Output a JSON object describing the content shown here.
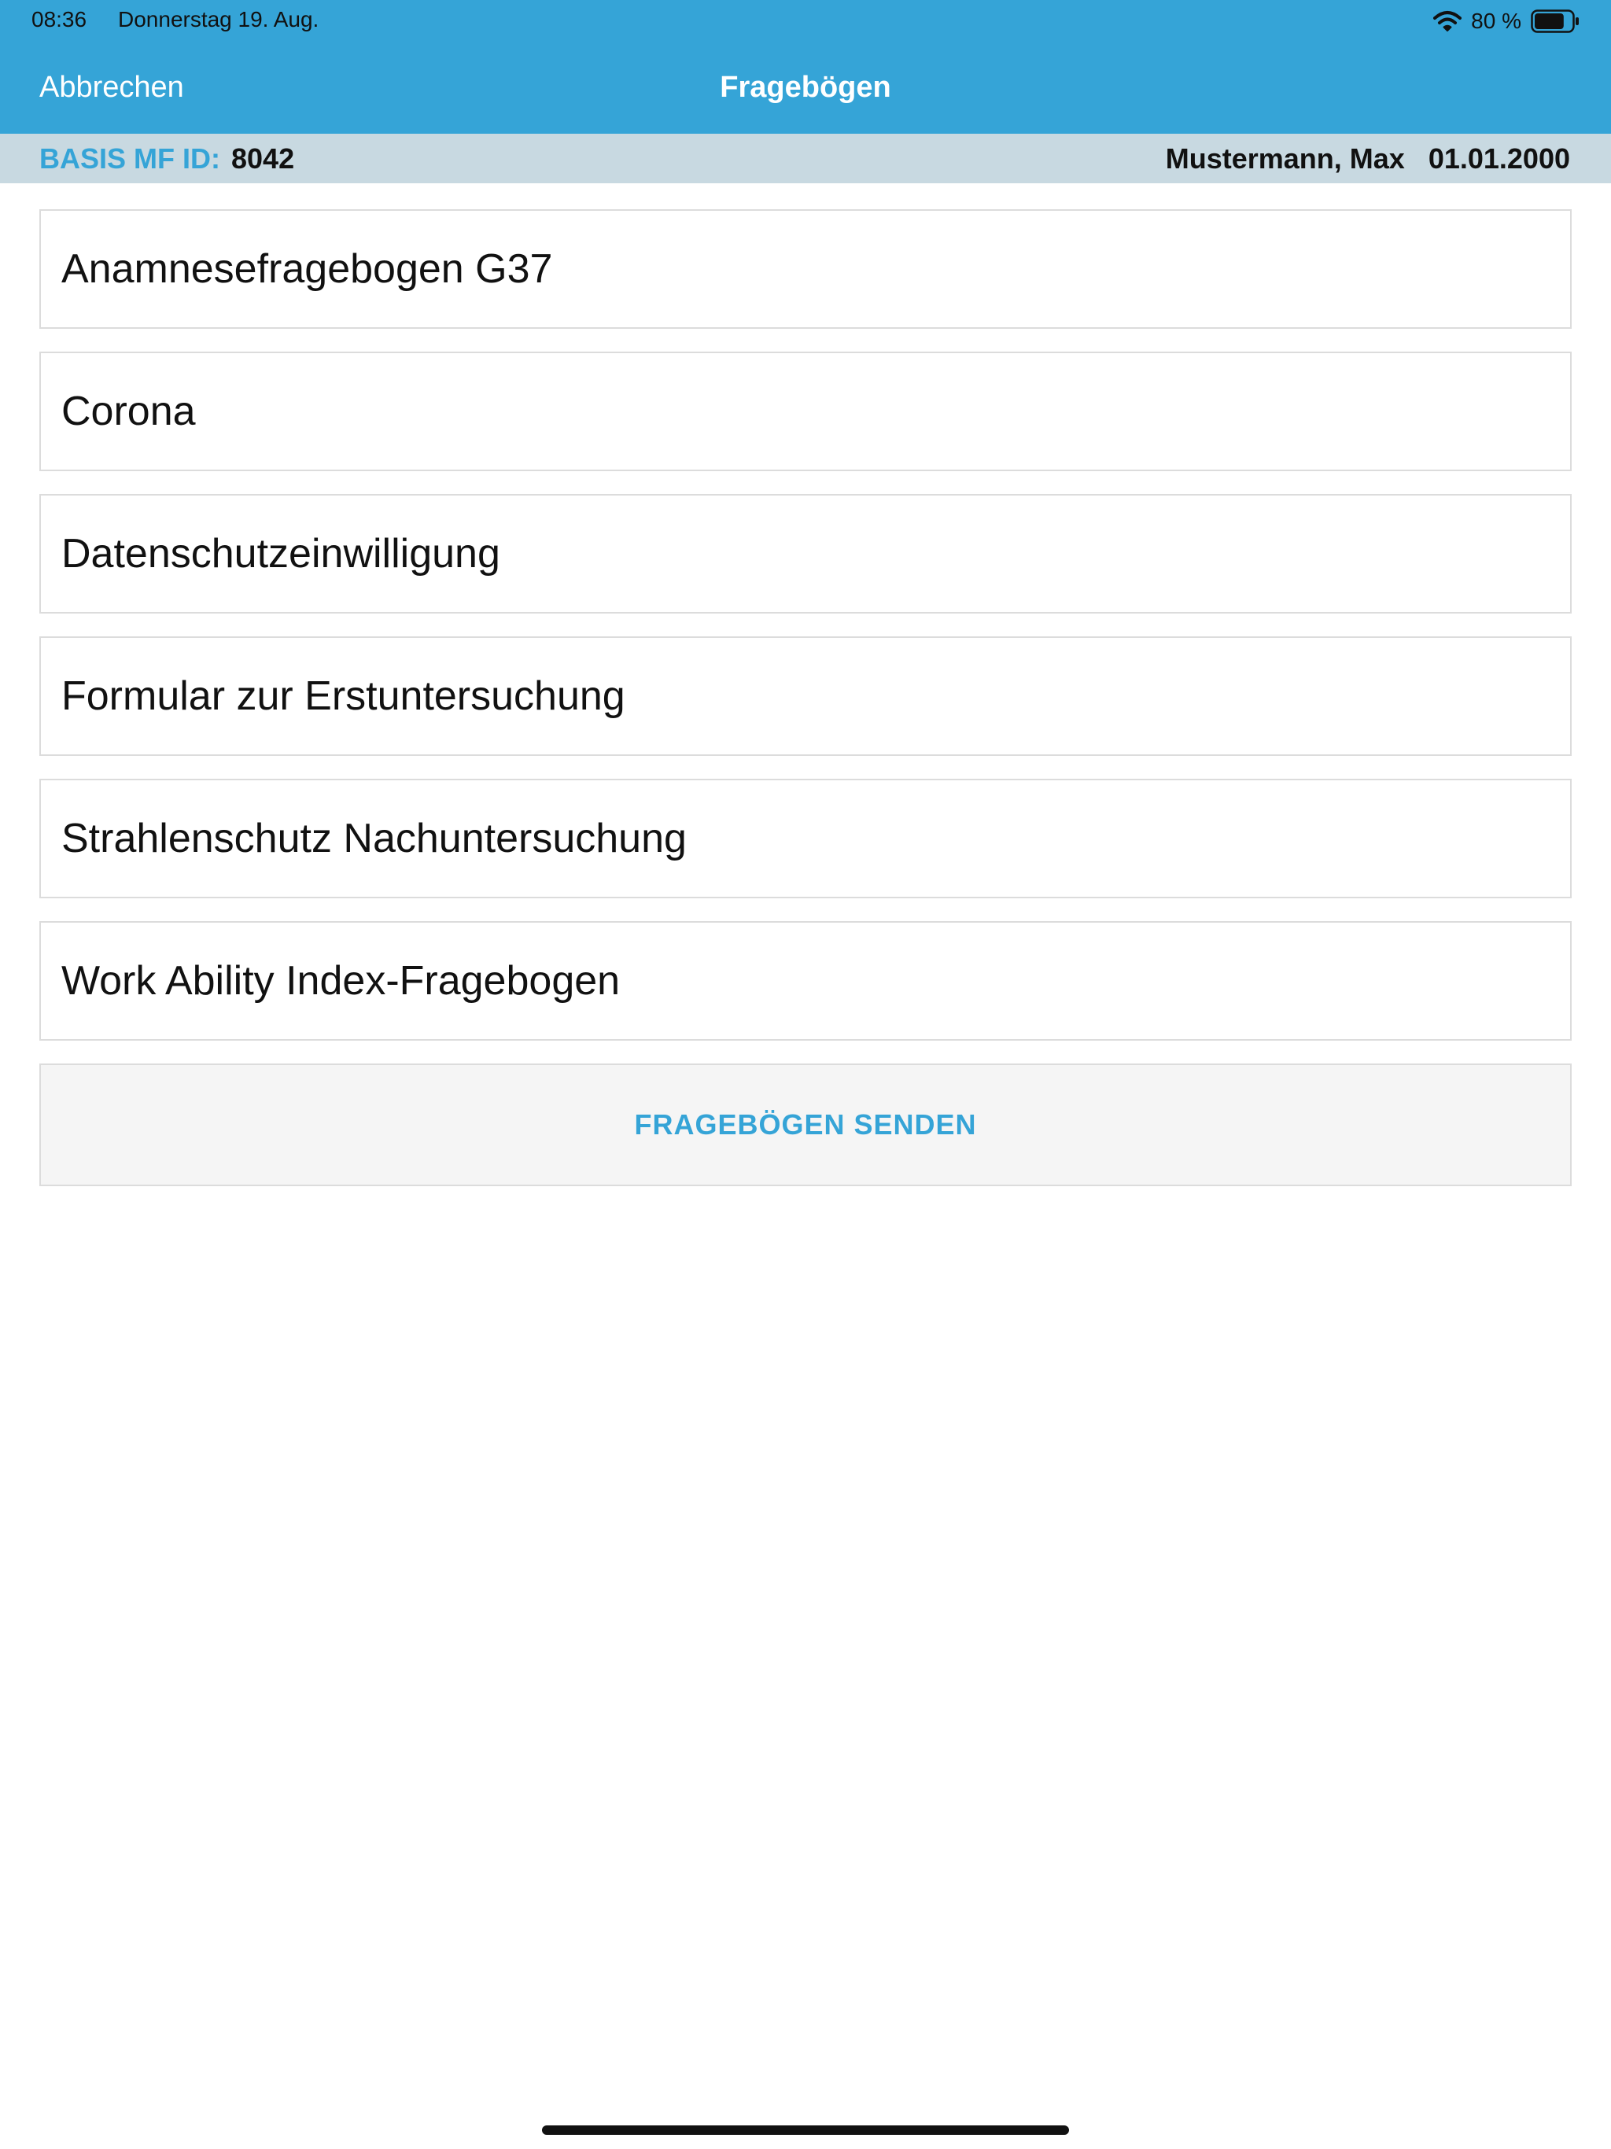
{
  "status_bar": {
    "time": "08:36",
    "date": "Donnerstag 19. Aug.",
    "battery_percent": "80 %",
    "battery_level": 0.8,
    "icons": [
      "wifi-icon",
      "battery-icon"
    ]
  },
  "nav": {
    "cancel_label": "Abbrechen",
    "title": "Fragebögen"
  },
  "info_bar": {
    "id_label": "BASIS MF ID:",
    "id_value": "8042",
    "patient_name": "Mustermann, Max",
    "birth_date": "01.01.2000"
  },
  "questionnaires": [
    {
      "label": "Anamnesefragebogen G37"
    },
    {
      "label": "Corona"
    },
    {
      "label": "Datenschutzeinwilligung"
    },
    {
      "label": "Formular zur Erstuntersuchung"
    },
    {
      "label": "Strahlenschutz Nachuntersuchung"
    },
    {
      "label": "Work Ability Index-Fragebogen"
    }
  ],
  "send_button": {
    "label": "FRAGEBÖGEN SENDEN"
  },
  "colors": {
    "header_background": "#35a4d7",
    "info_bar_background": "#c8d9e1",
    "accent": "#35a4d7"
  }
}
